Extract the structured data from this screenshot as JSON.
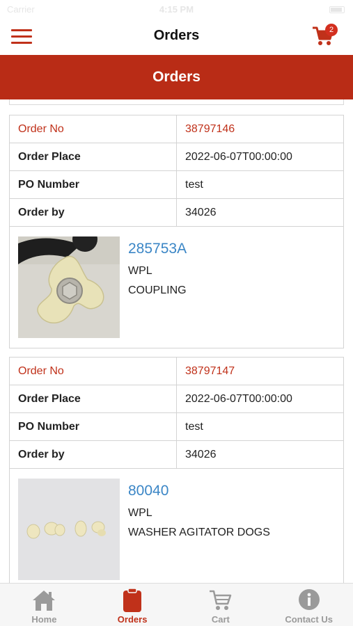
{
  "status_bar": {
    "carrier": "Carrier",
    "time": "4:15 PM"
  },
  "nav": {
    "title": "Orders",
    "cart_count": "2"
  },
  "banner": {
    "title": "Orders"
  },
  "labels": {
    "order_no": "Order No",
    "order_place": "Order Place",
    "po_number": "PO Number",
    "order_by": "Order by"
  },
  "orders": [
    {
      "order_no": "38797146",
      "order_place": "2022-06-07T00:00:00",
      "po_number": "test",
      "order_by": "34026",
      "product": {
        "code": "285753A",
        "brand": "WPL",
        "description": "COUPLING"
      }
    },
    {
      "order_no": "38797147",
      "order_place": "2022-06-07T00:00:00",
      "po_number": "test",
      "order_by": "34026",
      "product": {
        "code": "80040",
        "brand": "WPL",
        "description": "WASHER AGITATOR DOGS"
      }
    }
  ],
  "tabs": [
    {
      "label": "Home",
      "icon": "home-icon"
    },
    {
      "label": "Orders",
      "icon": "clipboard-icon"
    },
    {
      "label": "Cart",
      "icon": "cart-icon"
    },
    {
      "label": "Contact Us",
      "icon": "info-icon"
    }
  ],
  "colors": {
    "brand_red": "#b92c16",
    "accent_red": "#c0311a",
    "link_blue": "#3b86c6",
    "tab_inactive": "#9a9a9a"
  }
}
